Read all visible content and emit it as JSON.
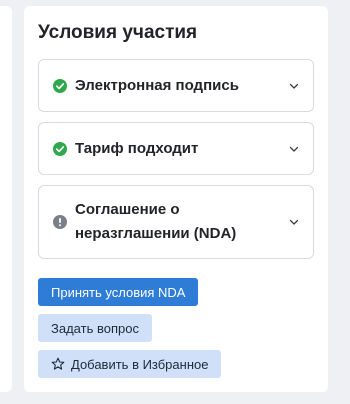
{
  "conditions": {
    "title": "Условия участия",
    "items": [
      {
        "label": "Электронная подпись",
        "status": "ok",
        "icon": "check-circle-icon"
      },
      {
        "label": "Тариф подходит",
        "status": "ok",
        "icon": "check-circle-icon"
      },
      {
        "label": "Соглашение о неразглашении (NDA)",
        "status": "warning",
        "icon": "exclamation-circle-icon"
      }
    ],
    "colors": {
      "ok": "#2ea84a",
      "warning": "#7a7f88",
      "primary": "#2e7cd6",
      "secondary": "#cfe0f8"
    }
  },
  "actions": {
    "accept_nda_label": "Принять условия NDA",
    "ask_question_label": "Задать вопрос",
    "add_favorite_label": "Добавить в Избранное",
    "add_favorite_icon": "star-outline-icon"
  }
}
